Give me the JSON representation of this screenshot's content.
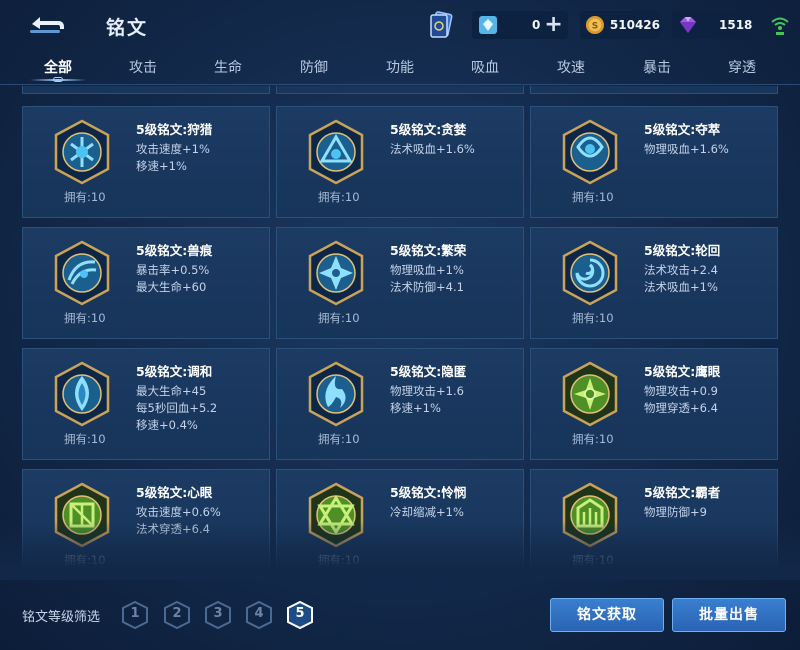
{
  "header": {
    "title": "铭文"
  },
  "currencies": [
    {
      "name": "diamond",
      "value": "0",
      "icon": "diamond-icon",
      "has_plus": true
    },
    {
      "name": "gold-coin",
      "value": "510426",
      "icon": "gold-coin-icon"
    },
    {
      "name": "gem",
      "value": "1518",
      "icon": "purple-gem-icon"
    }
  ],
  "tabs": [
    {
      "label": "全部",
      "active": true
    },
    {
      "label": "攻击"
    },
    {
      "label": "生命"
    },
    {
      "label": "防御"
    },
    {
      "label": "功能"
    },
    {
      "label": "吸血"
    },
    {
      "label": "攻速"
    },
    {
      "label": "暴击"
    },
    {
      "label": "穿透"
    }
  ],
  "cards": [
    {
      "name": "5级铭文:狩猎",
      "attrs": [
        "攻击速度+1%",
        "移速+1%"
      ],
      "owned": "拥有:10",
      "icon": "blue-rune-icon"
    },
    {
      "name": "5级铭文:贪婪",
      "attrs": [
        "法术吸血+1.6%"
      ],
      "owned": "拥有:10",
      "icon": "blue-rune-icon"
    },
    {
      "name": "5级铭文:夺萃",
      "attrs": [
        "物理吸血+1.6%"
      ],
      "owned": "拥有:10",
      "icon": "blue-rune-icon"
    },
    {
      "name": "5级铭文:兽痕",
      "attrs": [
        "暴击率+0.5%",
        "最大生命+60"
      ],
      "owned": "拥有:10",
      "icon": "blue-rune-icon"
    },
    {
      "name": "5级铭文:繁荣",
      "attrs": [
        "物理吸血+1%",
        "法术防御+4.1"
      ],
      "owned": "拥有:10",
      "icon": "blue-rune-icon"
    },
    {
      "name": "5级铭文:轮回",
      "attrs": [
        "法术攻击+2.4",
        "法术吸血+1%"
      ],
      "owned": "拥有:10",
      "icon": "blue-rune-icon"
    },
    {
      "name": "5级铭文:调和",
      "attrs": [
        "最大生命+45",
        "每5秒回血+5.2",
        "移速+0.4%"
      ],
      "owned": "拥有:10",
      "icon": "blue-rune-icon"
    },
    {
      "name": "5级铭文:隐匿",
      "attrs": [
        "物理攻击+1.6",
        "移速+1%"
      ],
      "owned": "拥有:10",
      "icon": "blue-rune-icon"
    },
    {
      "name": "5级铭文:鹰眼",
      "attrs": [
        "物理攻击+0.9",
        "物理穿透+6.4"
      ],
      "owned": "拥有:10",
      "icon": "green-rune-icon"
    },
    {
      "name": "5级铭文:心眼",
      "attrs": [
        "攻击速度+0.6%",
        "法术穿透+6.4"
      ],
      "owned": "拥有:10",
      "icon": "green-rune-icon"
    },
    {
      "name": "5级铭文:怜悯",
      "attrs": [
        "冷却缩减+1%"
      ],
      "owned": "拥有:10",
      "icon": "green-rune-icon"
    },
    {
      "name": "5级铭文:霸者",
      "attrs": [
        "物理防御+9"
      ],
      "owned": "拥有:10",
      "icon": "green-rune-icon"
    }
  ],
  "filter": {
    "label": "铭文等级筛选",
    "levels": [
      "1",
      "2",
      "3",
      "4",
      "5"
    ],
    "active_level": "5"
  },
  "buttons": {
    "acquire": "铭文获取",
    "bulk_sell": "批量出售"
  },
  "colors": {
    "accent_blue": "#3a7fd0",
    "rune_blue": "#3fa7e0",
    "rune_green": "#7ec93a",
    "gold_frame": "#c9a35a"
  }
}
